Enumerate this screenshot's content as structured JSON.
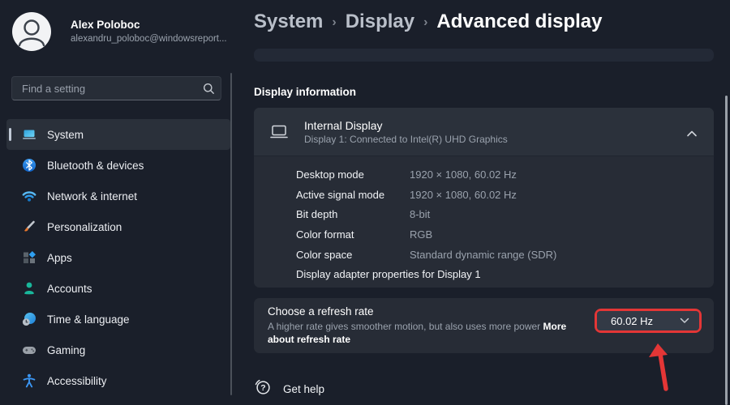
{
  "colors": {
    "annotation_red": "#e43636",
    "accent_blue": "#4cc2ff",
    "background": "#1a1f2a",
    "card": "#272c36"
  },
  "profile": {
    "name": "Alex Poloboc",
    "email": "alexandru_poloboc@windowsreport..."
  },
  "search": {
    "placeholder": "Find a setting"
  },
  "sidebar": {
    "items": [
      {
        "label": "System",
        "icon": "system-icon",
        "selected": true
      },
      {
        "label": "Bluetooth & devices",
        "icon": "bluetooth-icon",
        "selected": false
      },
      {
        "label": "Network & internet",
        "icon": "network-icon",
        "selected": false
      },
      {
        "label": "Personalization",
        "icon": "personalization-icon",
        "selected": false
      },
      {
        "label": "Apps",
        "icon": "apps-icon",
        "selected": false
      },
      {
        "label": "Accounts",
        "icon": "accounts-icon",
        "selected": false
      },
      {
        "label": "Time & language",
        "icon": "time-language-icon",
        "selected": false
      },
      {
        "label": "Gaming",
        "icon": "gaming-icon",
        "selected": false
      },
      {
        "label": "Accessibility",
        "icon": "accessibility-icon",
        "selected": false
      }
    ]
  },
  "breadcrumb": {
    "separator": "›",
    "items": [
      "System",
      "Display",
      "Advanced display"
    ]
  },
  "main": {
    "section_title": "Display information",
    "display_card": {
      "title": "Internal Display",
      "subtitle": "Display 1: Connected to Intel(R) UHD Graphics",
      "rows": [
        {
          "label": "Desktop mode",
          "value": "1920 × 1080, 60.02 Hz"
        },
        {
          "label": "Active signal mode",
          "value": "1920 × 1080, 60.02 Hz"
        },
        {
          "label": "Bit depth",
          "value": "8-bit"
        },
        {
          "label": "Color format",
          "value": "RGB"
        },
        {
          "label": "Color space",
          "value": "Standard dynamic range (SDR)"
        }
      ],
      "adapter_link": "Display adapter properties for Display 1"
    },
    "refresh_card": {
      "title": "Choose a refresh rate",
      "description": "A higher rate gives smoother motion, but also uses more power",
      "link_label": "More about refresh rate",
      "dropdown_value": "60.02 Hz"
    },
    "get_help_label": "Get help"
  }
}
